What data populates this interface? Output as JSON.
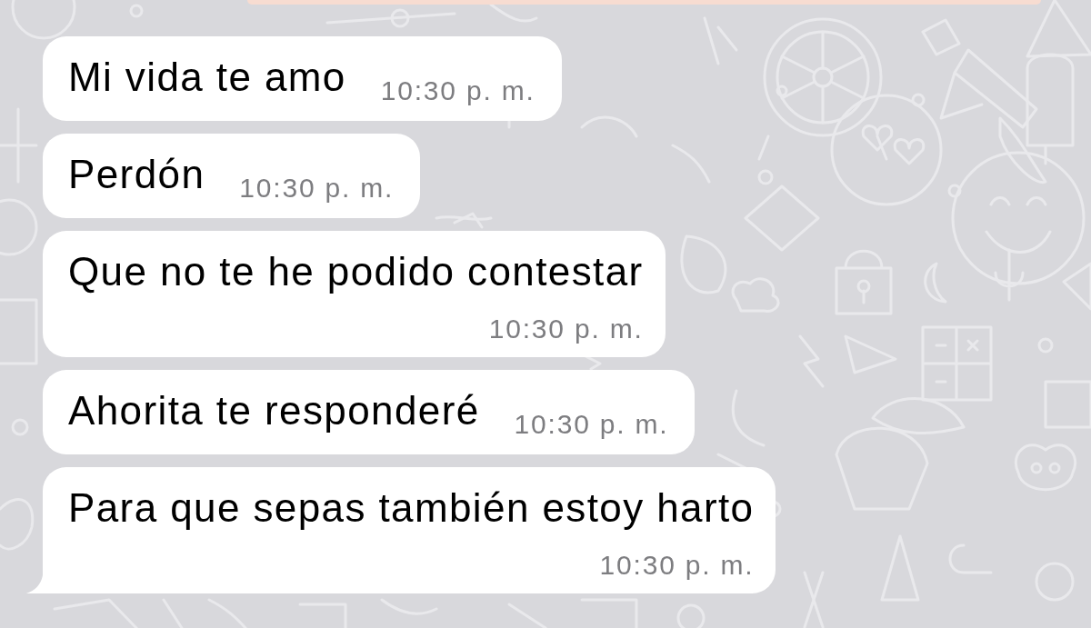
{
  "messages": [
    {
      "text": "Mi vida te amo",
      "time": "10:30 p. m.",
      "kind": "inline",
      "tail": false
    },
    {
      "text": "Perdón",
      "time": "10:30 p. m.",
      "kind": "inline",
      "tail": false
    },
    {
      "text": "Que no te he podido contestar",
      "time": "10:30 p. m.",
      "kind": "wrapped",
      "tail": false
    },
    {
      "text": "Ahorita te responderé",
      "time": "10:30 p. m.",
      "kind": "inline",
      "tail": false
    },
    {
      "text": "Para que sepas también estoy harto",
      "time": "10:30 p. m.",
      "kind": "wrapped",
      "tail": true
    }
  ]
}
